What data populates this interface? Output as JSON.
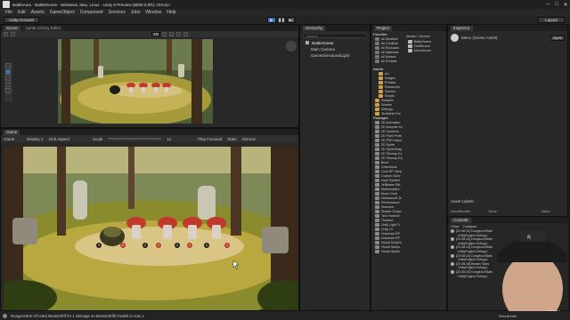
{
  "window": {
    "title": "BattleAuto - BattleScene - Windows, Mac, Linux - Unity 6 Preview (6000.0.0f1) <DX11>",
    "controls": [
      "–",
      "□",
      "✕"
    ]
  },
  "menu": {
    "items": [
      "File",
      "Edit",
      "Assets",
      "GameObject",
      "Component",
      "Services",
      "Jobs",
      "Window",
      "Help"
    ]
  },
  "toolbar": {
    "account": "Unity Account",
    "layout": "Layout"
  },
  "scene_panel": {
    "tabs": [
      "Scene",
      "Sprite Library Editor"
    ],
    "dimension_button": "2D"
  },
  "game_panel": {
    "tab": "Game",
    "display": "Display 1",
    "aspect": "16:9 Aspect",
    "scale_label": "Scale",
    "scale_value": "1x",
    "play_focused": "Play Focused",
    "stats": "Stats",
    "gizmos": "Gizmos"
  },
  "hierarchy": {
    "tab": "Hierarchy",
    "search_placeholder": "Search",
    "items": [
      "BattleScene",
      "Main Camera",
      "GameDirectionalLight"
    ]
  },
  "project": {
    "tab": "Project",
    "favorites_header": "Favorites",
    "favorites": [
      "All Modified",
      "All Conflicts",
      "All Excluded",
      "All Materials",
      "All Models",
      "All Prefabs"
    ],
    "assets_header": "Assets",
    "asset_folders": [
      "Art",
      "Images",
      "Prefabs",
      "Resources",
      "Scenes",
      "Scripts",
      "Samples",
      "Scenes",
      "Settings",
      "TextMesh Pro"
    ],
    "packages_header": "Packages",
    "packages": [
      "2D Animation",
      "2D Aseprite Im",
      "2D Common",
      "2D Pixel Perfe",
      "2D PSD Impor",
      "2D Sprite",
      "2D SpriteShap",
      "2D Tilemap Ex",
      "2D Tilemap Ed",
      "Burst",
      "Collections",
      "Core RP Libra",
      "Custom NUni",
      "Input System",
      "JetBrains Rid",
      "Mathematics",
      "Mono Cecil",
      "Newtonsoft Js",
      "Performance",
      "Searcher",
      "Shader Graph",
      "Test Framew",
      "Timeline",
      "Unity Light Tr",
      "Unity UI",
      "Universal RP",
      "Universal RP",
      "Visual Scriptin",
      "Visual Studio",
      "Visual Studio"
    ],
    "breadcrumb": "Assets > Scenes",
    "files": [
      "BattleScene",
      "DraftScene",
      "MenuScene"
    ]
  },
  "inspector": {
    "tab": "Inspector",
    "object_name": "Menu (Scene Asset)",
    "open_button": "Open",
    "asset_labels": "Asset Labels",
    "asset_bundle_label": "AssetBundle",
    "asset_bundle_value": "None",
    "asset_bundle_variant": "None"
  },
  "console": {
    "tab": "Console",
    "clear": "Clear",
    "collapse": "Collapse",
    "messages": [
      "[22:08:10] Dungeon/Stats",
      "UnityEngine.Debug:L",
      "[22:08:10] Dungeon/Stats",
      "UnityEngine.Debug:L",
      "[22:08:10] Dungeon/Stats",
      "UnityEngine.Debug:L",
      "[22:08:10] Dungeon/Stats",
      "UnityEngine.Debug:L",
      "[22:08:18] Beasts Stats",
      "UnityEngine.Debug:L",
      "[22:08:10] Dungeon/Stats",
      "UnityEngine.Debug:L"
    ]
  },
  "status_bar": {
    "message": "DungeonEnt ef'ected Beasts/Elf for 1 damage so Beasts/ElfD health is now 1",
    "right_text": "Rebuild/Ink"
  },
  "watermark": "udemy",
  "game_view": {
    "turn_numbers": [
      "2",
      "2",
      "1",
      "1",
      "1",
      "1",
      "1",
      "1"
    ]
  },
  "colors": {
    "accent_play": "#3d6fb8",
    "selected_row": "#2c5d87",
    "folder": "#c9a24a",
    "enemy_red": "#c0392b"
  }
}
